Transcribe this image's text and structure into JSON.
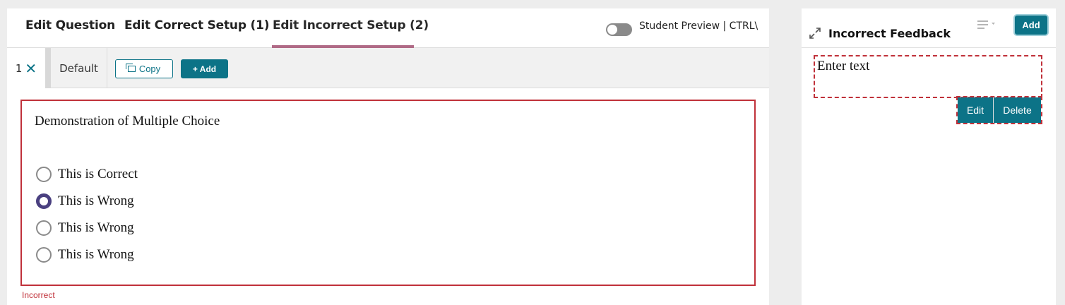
{
  "tabs": [
    {
      "label": "Edit Question"
    },
    {
      "label": "Edit Correct Setup (1)"
    },
    {
      "label": "Edit Incorrect Setup (2)"
    }
  ],
  "active_tab_index": 2,
  "preview": {
    "label": "Student Preview | CTRL\\",
    "enabled": false
  },
  "setup": {
    "number": "1",
    "default_label": "Default",
    "copy_label": "Copy",
    "add_label": "+ Add"
  },
  "question": {
    "title": "Demonstration of Multiple Choice",
    "choices": [
      {
        "label": "This is Correct",
        "selected": false
      },
      {
        "label": "This is Wrong",
        "selected": true
      },
      {
        "label": "This is Wrong",
        "selected": false
      },
      {
        "label": "This is Wrong",
        "selected": false
      }
    ],
    "status": "Incorrect"
  },
  "feedback": {
    "title": "Incorrect Feedback",
    "add_label": "Add",
    "placeholder_text": "Enter text",
    "edit_label": "Edit",
    "delete_label": "Delete"
  },
  "colors": {
    "accent": "#0c7387",
    "error": "#c0313a",
    "tab_underline": "#b06a86",
    "radio_selected": "#4a4080"
  }
}
